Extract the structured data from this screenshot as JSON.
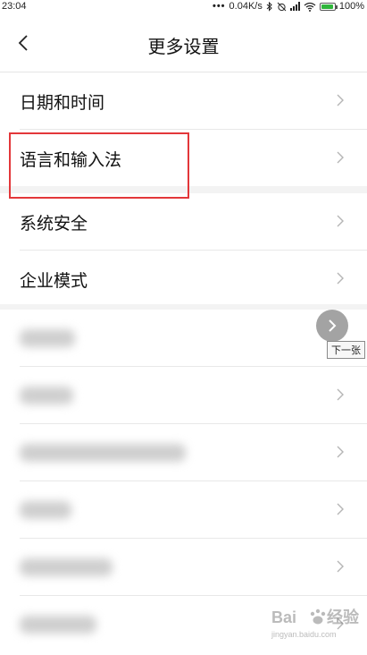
{
  "status_bar": {
    "time": "23:04",
    "net_speed": "0.04K/s",
    "battery_percent": "100%",
    "battery_color": "#2fb53b"
  },
  "header": {
    "title": "更多设置",
    "back_icon": "chevron-left-icon"
  },
  "settings_items": [
    {
      "label": "日期和时间"
    },
    {
      "label": "语言和输入法"
    },
    {
      "label": "系统安全"
    },
    {
      "label": "企业模式"
    }
  ],
  "highlight_color": "#e3373a",
  "overlay": {
    "next_tooltip": "下一张"
  },
  "watermark": {
    "site": "jingyan.baidu.com"
  }
}
